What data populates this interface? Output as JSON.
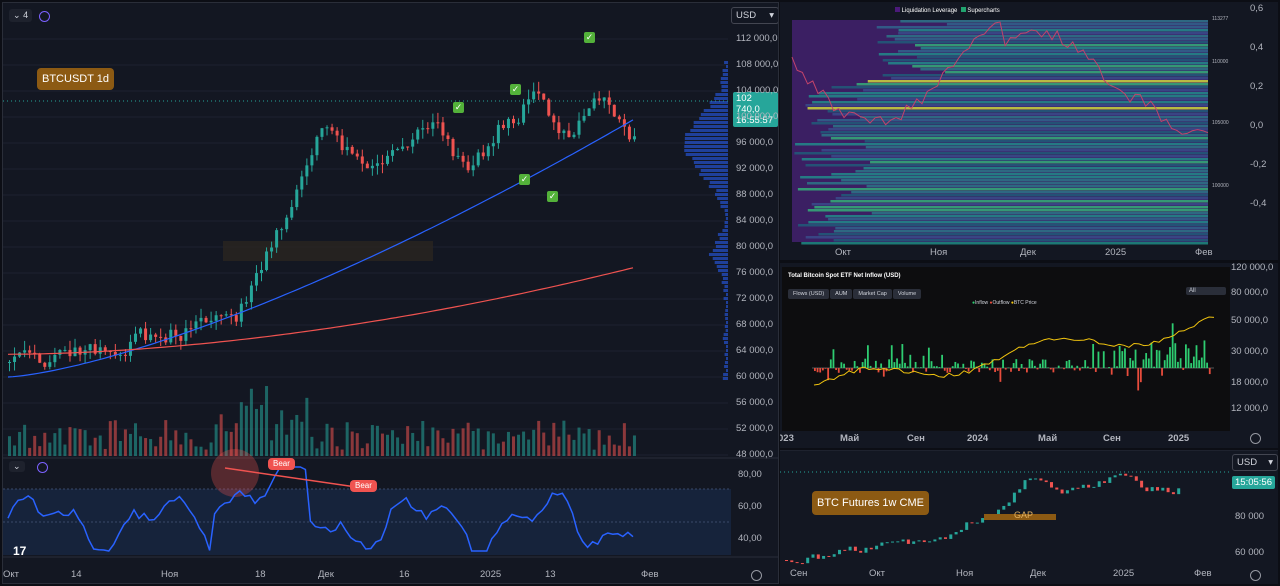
{
  "left_chart": {
    "collapse_count": "4",
    "currency": "USD",
    "symbol_label": "BTCUSDT 1d",
    "price_axis": [
      "112 000,0",
      "108 000,0",
      "104 000,0",
      "100 000,0",
      "96 000,0",
      "92 000,0",
      "88 000,0",
      "84 000,0",
      "80 000,0",
      "76 000,0",
      "72 000,0",
      "68 000,0",
      "64 000,0",
      "60 000,0",
      "56 000,0",
      "52 000,0",
      "48 000,0"
    ],
    "last_price": "102 740,0",
    "countdown": "16:55:57",
    "time_axis": [
      "Окт",
      "14",
      "Ноя",
      "18",
      "Дек",
      "16",
      "2025",
      "13",
      "Фев"
    ],
    "divergence_labels": [
      "Bear",
      "Bear"
    ],
    "oscillator_axis": [
      "80,00",
      "60,00",
      "40,00"
    ],
    "colors": {
      "up": "#26a69a",
      "down": "#ef5350",
      "ma_blue": "#2962ff",
      "ma_red": "#ef5350",
      "osc": "#2962ff"
    }
  },
  "heatmap": {
    "legend": [
      "Liquidation Leverage",
      "Supercharts"
    ],
    "inner_axis": [
      "113277",
      "110000",
      "105000",
      "100000"
    ],
    "right_axis": [
      "0,6",
      "0,4",
      "0,2",
      "0,0",
      "-0,2",
      "-0,4"
    ],
    "time_axis": [
      "Окт",
      "Ноя",
      "Дек",
      "2025",
      "Фев"
    ]
  },
  "etf_chart": {
    "title": "Total Bitcoin Spot ETF Net Inflow (USD)",
    "tabs": [
      "Flows (USD)",
      "AUM",
      "Market Cap",
      "Volume"
    ],
    "range_select": "All",
    "legend": [
      "Inflow",
      "Outflow",
      "BTC Price"
    ],
    "right_axis": [
      "120 000,0",
      "80 000,0",
      "50 000,0",
      "30 000,0",
      "18 000,0",
      "12 000,0"
    ],
    "time_axis": [
      "023",
      "Май",
      "Сен",
      "2024",
      "Май",
      "Сен",
      "2025"
    ]
  },
  "cme_chart": {
    "currency": "USD",
    "symbol_label": "BTC Futures 1w CME",
    "gap_label": "GAP",
    "price_tag": "15:05:56",
    "right_axis": [
      "80 000",
      "60 000"
    ],
    "time_axis": [
      "Сен",
      "Окт",
      "Ноя",
      "Дек",
      "2025",
      "Фев"
    ]
  }
}
